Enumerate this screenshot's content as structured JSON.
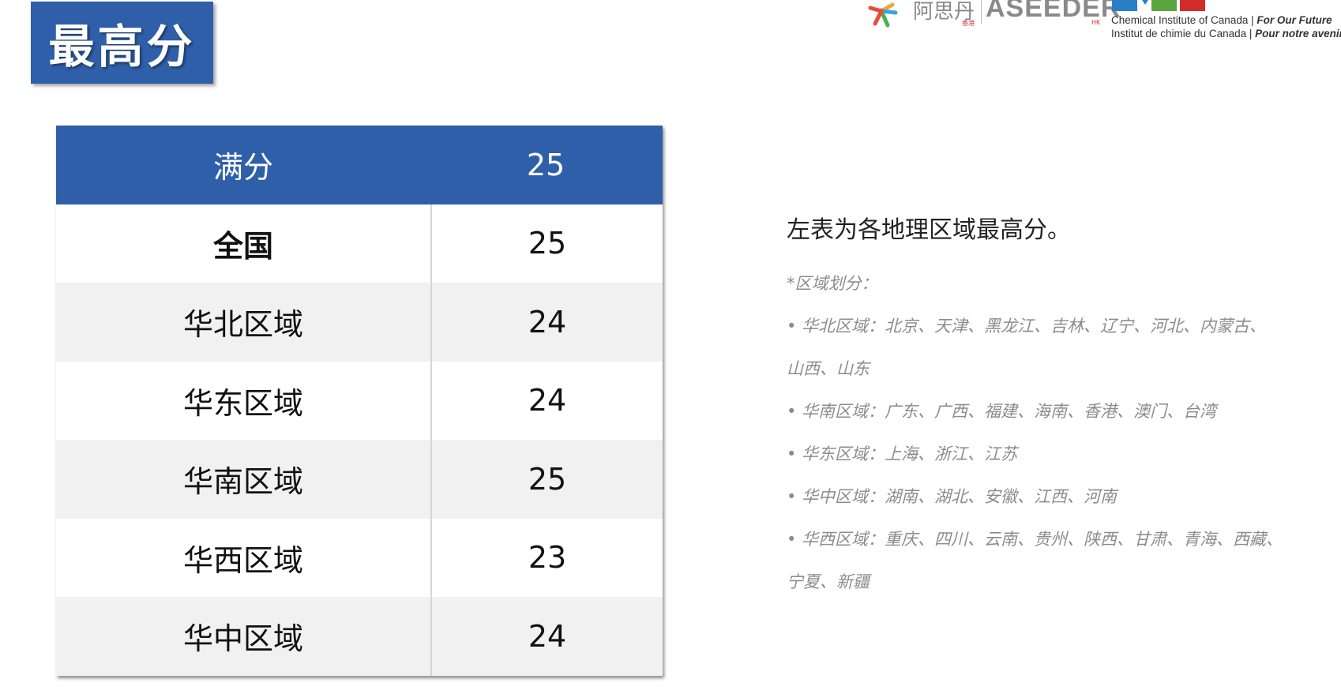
{
  "title": "最高分",
  "logos": {
    "asidan_cn": "阿思丹",
    "asidan_hk": "香港",
    "aseeder": "ASEEDER",
    "aseeder_hk": "HK",
    "cic_en_plain": "Chemical Institute of Canada | ",
    "cic_en_bold": "For Our Future",
    "cic_fr_plain": "Institut de chimie du Canada | ",
    "cic_fr_bold": "Pour notre avenir"
  },
  "table": {
    "header": {
      "label": "满分",
      "value": "25"
    },
    "rows": [
      {
        "label": "全国",
        "value": "25"
      },
      {
        "label": "华北区域",
        "value": "24"
      },
      {
        "label": "华东区域",
        "value": "24"
      },
      {
        "label": "华南区域",
        "value": "25"
      },
      {
        "label": "华西区域",
        "value": "23"
      },
      {
        "label": "华中区域",
        "value": "24"
      }
    ]
  },
  "notes": {
    "intro": "左表为各地理区域最高分。",
    "lines": [
      "*区域划分：",
      "• 华北区域：北京、天津、黑龙江、吉林、辽宁、河北、内蒙古、",
      "山西、山东",
      "• 华南区域：广东、广西、福建、海南、香港、澳门、台湾",
      "• 华东区域：上海、浙江、江苏",
      "• 华中区域：湖南、湖北、安徽、江西、河南",
      "• 华西区域：重庆、四川、云南、贵州、陕西、甘肃、青海、西藏、",
      "宁夏、新疆"
    ]
  },
  "colors": {
    "accent_blue": "#2f5fa9",
    "row_gray": "#f1f1f1",
    "note_gray": "#8c8c8c"
  }
}
